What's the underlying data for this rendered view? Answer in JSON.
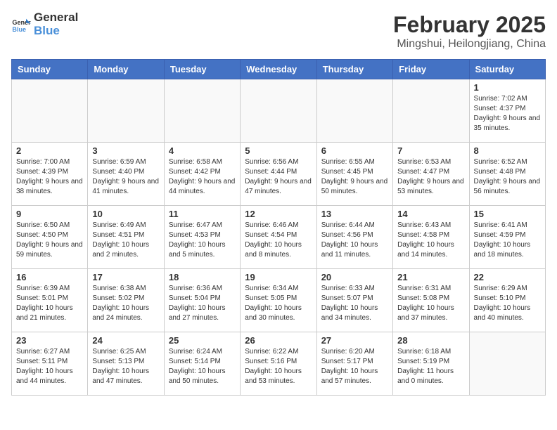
{
  "logo": {
    "general": "General",
    "blue": "Blue"
  },
  "title": "February 2025",
  "subtitle": "Mingshui, Heilongjiang, China",
  "days_of_week": [
    "Sunday",
    "Monday",
    "Tuesday",
    "Wednesday",
    "Thursday",
    "Friday",
    "Saturday"
  ],
  "weeks": [
    [
      {
        "day": "",
        "info": ""
      },
      {
        "day": "",
        "info": ""
      },
      {
        "day": "",
        "info": ""
      },
      {
        "day": "",
        "info": ""
      },
      {
        "day": "",
        "info": ""
      },
      {
        "day": "",
        "info": ""
      },
      {
        "day": "1",
        "info": "Sunrise: 7:02 AM\nSunset: 4:37 PM\nDaylight: 9 hours and 35 minutes."
      }
    ],
    [
      {
        "day": "2",
        "info": "Sunrise: 7:00 AM\nSunset: 4:39 PM\nDaylight: 9 hours and 38 minutes."
      },
      {
        "day": "3",
        "info": "Sunrise: 6:59 AM\nSunset: 4:40 PM\nDaylight: 9 hours and 41 minutes."
      },
      {
        "day": "4",
        "info": "Sunrise: 6:58 AM\nSunset: 4:42 PM\nDaylight: 9 hours and 44 minutes."
      },
      {
        "day": "5",
        "info": "Sunrise: 6:56 AM\nSunset: 4:44 PM\nDaylight: 9 hours and 47 minutes."
      },
      {
        "day": "6",
        "info": "Sunrise: 6:55 AM\nSunset: 4:45 PM\nDaylight: 9 hours and 50 minutes."
      },
      {
        "day": "7",
        "info": "Sunrise: 6:53 AM\nSunset: 4:47 PM\nDaylight: 9 hours and 53 minutes."
      },
      {
        "day": "8",
        "info": "Sunrise: 6:52 AM\nSunset: 4:48 PM\nDaylight: 9 hours and 56 minutes."
      }
    ],
    [
      {
        "day": "9",
        "info": "Sunrise: 6:50 AM\nSunset: 4:50 PM\nDaylight: 9 hours and 59 minutes."
      },
      {
        "day": "10",
        "info": "Sunrise: 6:49 AM\nSunset: 4:51 PM\nDaylight: 10 hours and 2 minutes."
      },
      {
        "day": "11",
        "info": "Sunrise: 6:47 AM\nSunset: 4:53 PM\nDaylight: 10 hours and 5 minutes."
      },
      {
        "day": "12",
        "info": "Sunrise: 6:46 AM\nSunset: 4:54 PM\nDaylight: 10 hours and 8 minutes."
      },
      {
        "day": "13",
        "info": "Sunrise: 6:44 AM\nSunset: 4:56 PM\nDaylight: 10 hours and 11 minutes."
      },
      {
        "day": "14",
        "info": "Sunrise: 6:43 AM\nSunset: 4:58 PM\nDaylight: 10 hours and 14 minutes."
      },
      {
        "day": "15",
        "info": "Sunrise: 6:41 AM\nSunset: 4:59 PM\nDaylight: 10 hours and 18 minutes."
      }
    ],
    [
      {
        "day": "16",
        "info": "Sunrise: 6:39 AM\nSunset: 5:01 PM\nDaylight: 10 hours and 21 minutes."
      },
      {
        "day": "17",
        "info": "Sunrise: 6:38 AM\nSunset: 5:02 PM\nDaylight: 10 hours and 24 minutes."
      },
      {
        "day": "18",
        "info": "Sunrise: 6:36 AM\nSunset: 5:04 PM\nDaylight: 10 hours and 27 minutes."
      },
      {
        "day": "19",
        "info": "Sunrise: 6:34 AM\nSunset: 5:05 PM\nDaylight: 10 hours and 30 minutes."
      },
      {
        "day": "20",
        "info": "Sunrise: 6:33 AM\nSunset: 5:07 PM\nDaylight: 10 hours and 34 minutes."
      },
      {
        "day": "21",
        "info": "Sunrise: 6:31 AM\nSunset: 5:08 PM\nDaylight: 10 hours and 37 minutes."
      },
      {
        "day": "22",
        "info": "Sunrise: 6:29 AM\nSunset: 5:10 PM\nDaylight: 10 hours and 40 minutes."
      }
    ],
    [
      {
        "day": "23",
        "info": "Sunrise: 6:27 AM\nSunset: 5:11 PM\nDaylight: 10 hours and 44 minutes."
      },
      {
        "day": "24",
        "info": "Sunrise: 6:25 AM\nSunset: 5:13 PM\nDaylight: 10 hours and 47 minutes."
      },
      {
        "day": "25",
        "info": "Sunrise: 6:24 AM\nSunset: 5:14 PM\nDaylight: 10 hours and 50 minutes."
      },
      {
        "day": "26",
        "info": "Sunrise: 6:22 AM\nSunset: 5:16 PM\nDaylight: 10 hours and 53 minutes."
      },
      {
        "day": "27",
        "info": "Sunrise: 6:20 AM\nSunset: 5:17 PM\nDaylight: 10 hours and 57 minutes."
      },
      {
        "day": "28",
        "info": "Sunrise: 6:18 AM\nSunset: 5:19 PM\nDaylight: 11 hours and 0 minutes."
      },
      {
        "day": "",
        "info": ""
      }
    ]
  ]
}
